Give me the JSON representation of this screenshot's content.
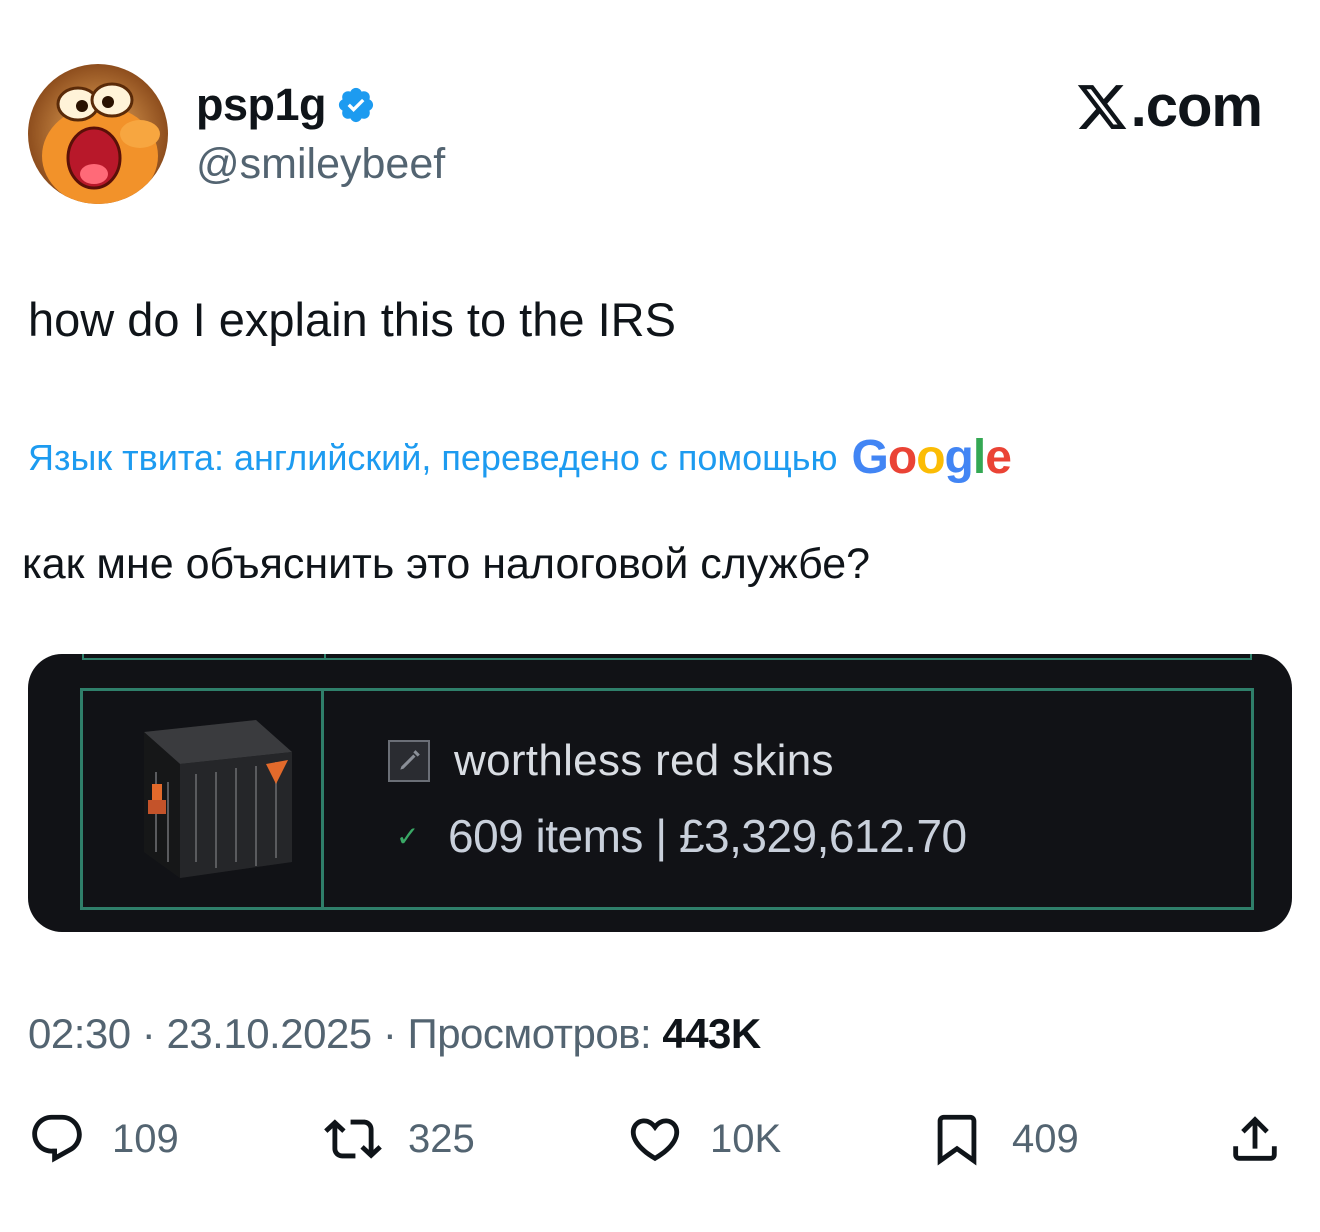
{
  "author": {
    "display_name": "psp1g",
    "handle": "@smileybeef",
    "verified": true,
    "avatar_icon": "orange-smiling-blob-avatar"
  },
  "brand": {
    "domain_suffix": ".com",
    "logo_icon": "x-logo-icon"
  },
  "tweet": {
    "text": "how do I explain this to the IRS",
    "translation_notice": "Язык твита: английский, переведено с помощью",
    "translation_provider": [
      "G",
      "o",
      "o",
      "g",
      "l",
      "e"
    ],
    "translated_text": "как мне объяснить это налоговой службе?"
  },
  "media": {
    "inventory_name": "worthless red skins",
    "inventory_summary": "609 items | £3,329,612.70",
    "edit_icon": "pencil-icon",
    "check_icon": "checkmark-icon",
    "item_image": "dark-weapon-case-icon"
  },
  "meta": {
    "time": "02:30",
    "separator": "·",
    "date": "23.10.2025",
    "views_label": "Просмотров:",
    "views_count": "443K"
  },
  "actions": {
    "replies": "109",
    "reposts": "325",
    "likes": "10K",
    "bookmarks": "409"
  },
  "colors": {
    "link_blue": "#1d9bf0",
    "secondary_text": "#536471",
    "primary_text": "#0f1419",
    "media_bg": "#111216",
    "media_border": "#2f7f6a"
  }
}
